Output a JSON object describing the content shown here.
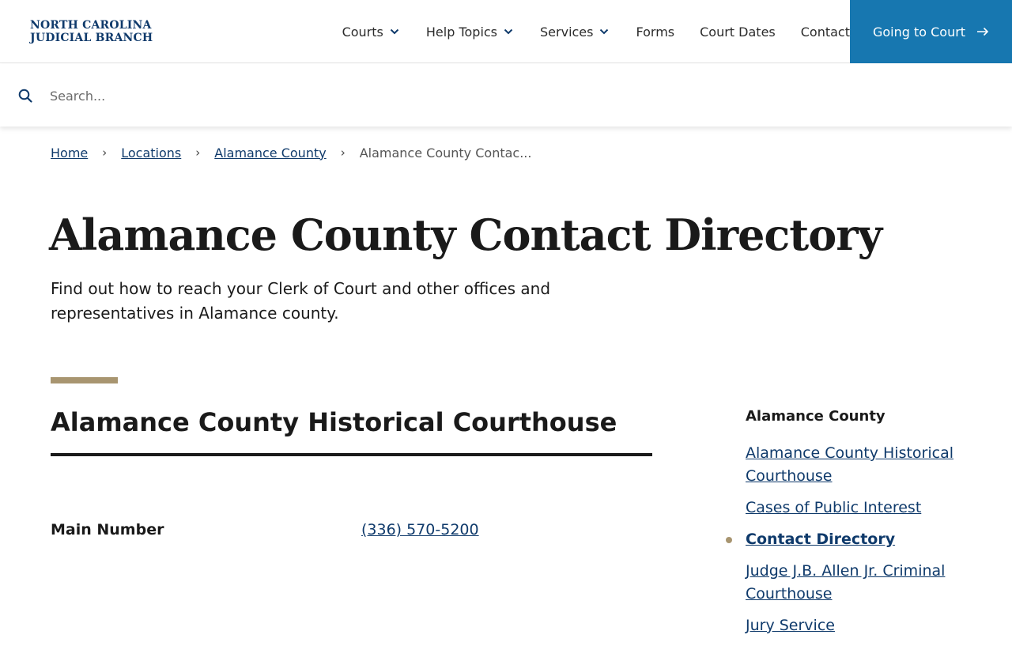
{
  "header": {
    "logo_line1": "NORTH CAROLINA",
    "logo_line2": "JUDICIAL BRANCH",
    "nav": [
      {
        "label": "Courts",
        "dropdown": true
      },
      {
        "label": "Help Topics",
        "dropdown": true
      },
      {
        "label": "Services",
        "dropdown": true
      },
      {
        "label": "Forms",
        "dropdown": false
      },
      {
        "label": "Court Dates",
        "dropdown": false
      },
      {
        "label": "Contact",
        "dropdown": false
      }
    ],
    "cta_label": "Going to Court"
  },
  "search": {
    "placeholder": "Search...",
    "value": ""
  },
  "breadcrumb": {
    "items": [
      "Home",
      "Locations",
      "Alamance County"
    ],
    "current": "Alamance County Contac..."
  },
  "page": {
    "title": "Alamance County Contact Directory",
    "intro": "Find out how to reach your Clerk of Court and other offices and representatives in Alamance county."
  },
  "section": {
    "title": "Alamance County Historical Courthouse",
    "contacts": [
      {
        "label": "Main Number",
        "value": "(336) 570-5200"
      }
    ]
  },
  "sidenav": {
    "title": "Alamance County",
    "items": [
      {
        "label": "Alamance County Historical Courthouse",
        "active": false
      },
      {
        "label": "Cases of Public Interest",
        "active": false
      },
      {
        "label": "Contact Directory",
        "active": true
      },
      {
        "label": "Judge J.B. Allen Jr. Criminal Courthouse",
        "active": false
      },
      {
        "label": "Jury Service",
        "active": false
      }
    ]
  },
  "colors": {
    "brand_navy": "#0f3a6b",
    "cta_blue": "#1777b0",
    "accent_gold": "#a89570",
    "text": "#1a1a1a"
  },
  "icons": {
    "search": "search-icon",
    "dropdown": "chevron-down-icon",
    "cta": "arrow-right-icon",
    "breadcrumb_sep": "chevron-right-icon"
  }
}
